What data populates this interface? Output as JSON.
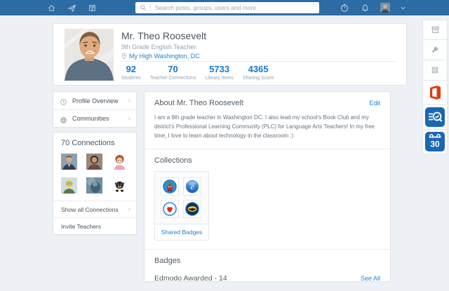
{
  "colors": {
    "nav_blue": "#2d6ca3",
    "page_bg": "#edf0f4",
    "link_blue": "#1e82d0",
    "stat_blue": "#1878cc",
    "office_orange": "#db3e13",
    "app_icon_blue": "#1b67b2"
  },
  "nav": {
    "search_placeholder": "Search posts, groups, users and more",
    "left_icons": [
      "home",
      "spotlight",
      "library"
    ],
    "right_icons": [
      "planner",
      "notifications",
      "account-avatar"
    ]
  },
  "rail_icons": [
    "archive-box",
    "wrench",
    "apps-grid",
    "office",
    "library-search",
    "calendar-30"
  ],
  "profile": {
    "name": "Mr. Theo Roosevelt",
    "role": "9th Grade English Teacher",
    "location": "My High Washington, DC",
    "stats": [
      {
        "value": "92",
        "label": "Students"
      },
      {
        "value": "70",
        "label": "Teacher Connections"
      },
      {
        "value": "5733",
        "label": "Library Items"
      },
      {
        "value": "4365",
        "label": "Sharing Score"
      }
    ]
  },
  "sidebar": {
    "menu": [
      {
        "label": "Profile Overview",
        "icon": "clock"
      },
      {
        "label": "Communities",
        "icon": "globe"
      }
    ],
    "connections_title": "70 Connections",
    "show_all_label": "Show all Connections",
    "invite_label": "Invite Teachers",
    "connection_avatars": [
      "man-in-suit",
      "woman",
      "cartoon-girl",
      "yellow-cartoon",
      "blurry-photo",
      "dog"
    ]
  },
  "main": {
    "about": {
      "title": "About Mr. Theo Roosevelt",
      "edit_label": "Edit",
      "body": "I am a 9th grade teacher in Washington DC. I also lead my school's Book Club and my district's Professional Learning Community (PLC) for Language Arts Teachers! In my free time, I love to learn about technology in the classroom :)"
    },
    "collections": {
      "title": "Collections",
      "badge_icons": [
        "monster-badge",
        "explorer-e-badge",
        "heart-badge",
        "batman-badge"
      ],
      "shared_badges_label": "Shared Badges"
    },
    "badges": {
      "title": "Badges",
      "awarded_label": "Edmodo Awarded - 14",
      "see_all_label": "See All"
    }
  }
}
